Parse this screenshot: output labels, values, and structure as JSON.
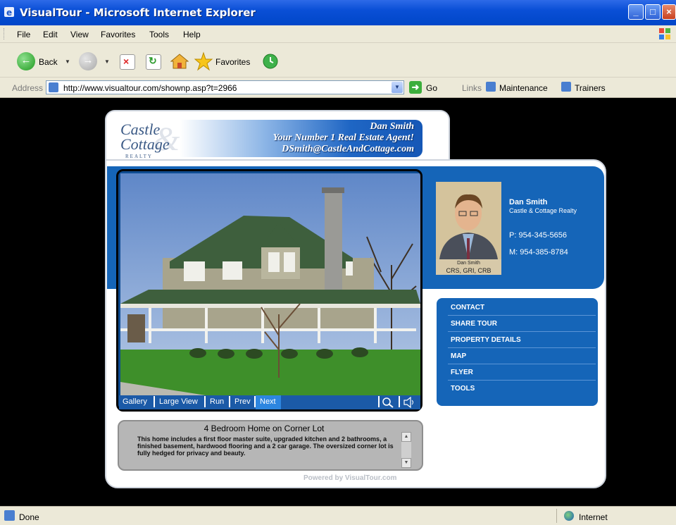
{
  "window": {
    "title": "VisualTour - Microsoft Internet Explorer"
  },
  "menubar": {
    "items": [
      "File",
      "Edit",
      "View",
      "Favorites",
      "Tools",
      "Help"
    ]
  },
  "toolbar": {
    "back_label": "Back",
    "favorites_label": "Favorites"
  },
  "addressbar": {
    "label": "Address",
    "url": "http://www.visualtour.com/shownp.asp?t=2966",
    "go_label": "Go",
    "links_label": "Links",
    "links": [
      "Maintenance",
      "Trainers"
    ]
  },
  "brand": {
    "logo_line1": "Castle",
    "logo_line2": "Cottage",
    "logo_line3": "REALTY",
    "logo_amp": "&",
    "banner_name": "Dan Smith",
    "banner_tagline": "Your Number 1 Real Estate Agent!",
    "banner_email": "DSmith@CastleAndCottage.com"
  },
  "photo_nav": {
    "gallery": "Gallery",
    "large_view": "Large View",
    "run": "Run",
    "prev": "Prev",
    "next": "Next"
  },
  "agent": {
    "caption_name": "Dan Smith",
    "caption_creds": "CRS, GRI, CRB",
    "name": "Dan Smith",
    "company": "Castle & Cottage Realty",
    "phone": "P: 954-345-5656",
    "mobile": "M: 954-385-8784"
  },
  "menu": {
    "items": [
      "CONTACT",
      "SHARE TOUR",
      "PROPERTY DETAILS",
      "MAP",
      "FLYER",
      "TOOLS"
    ]
  },
  "description": {
    "title": "4 Bedroom Home on Corner Lot",
    "text": "This home includes a first floor master suite, upgraded kitchen and 2 bathrooms, a finished basement, hardwood flooring and a 2 car garage. The oversized corner lot is fully hedged for privacy and beauty."
  },
  "footer": {
    "powered": "Powered by VisualTour.com"
  },
  "statusbar": {
    "status": "Done",
    "zone": "Internet"
  },
  "colors": {
    "brand_blue": "#1565b8",
    "titlebar_blue": "#0a4fd6",
    "chrome": "#ece9d8"
  }
}
